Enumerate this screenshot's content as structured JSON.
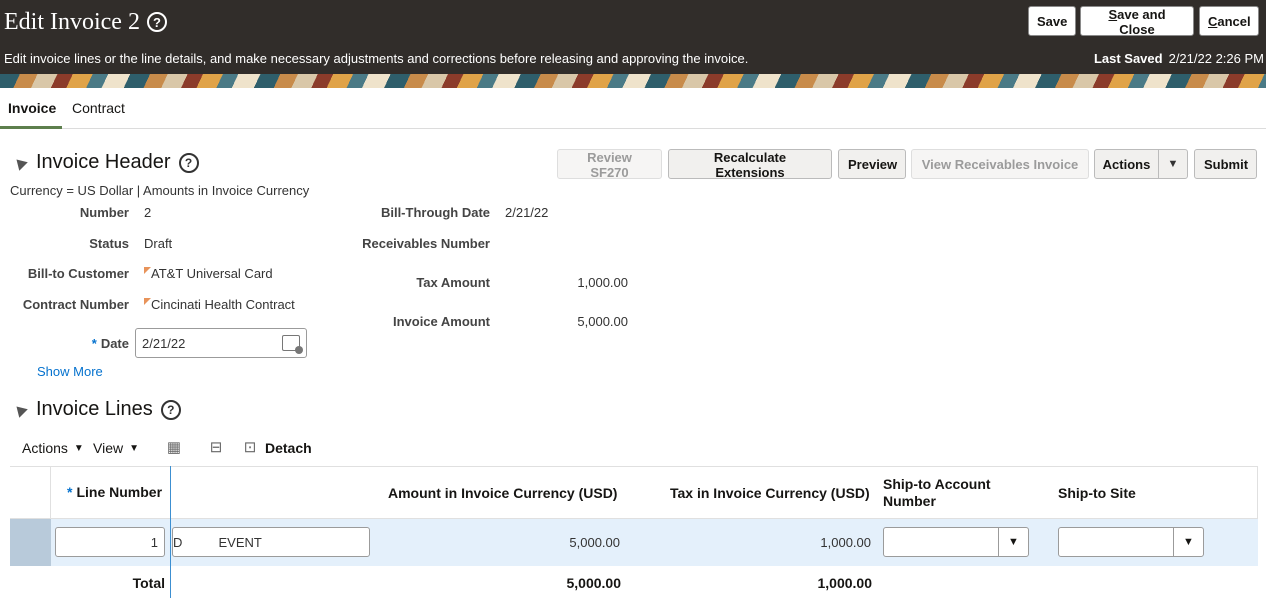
{
  "header": {
    "title": "Edit Invoice 2",
    "help": "?",
    "subtitle": "Edit invoice lines or the line details, and make necessary adjustments and corrections before releasing and approving the invoice.",
    "last_saved_label": "Last Saved",
    "last_saved_value": "2/21/22 2:26 PM",
    "save": "Save",
    "save_close_s": "S",
    "save_close_rest": "ave and Close",
    "cancel_c": "C",
    "cancel_rest": "ancel"
  },
  "tabs": [
    {
      "label": "Invoice",
      "active": true
    },
    {
      "label": "Contract",
      "active": false
    }
  ],
  "invoice_header": {
    "title": "Invoice Header",
    "help": "?",
    "buttons": {
      "review": "Review SF270",
      "recalc": "Recalculate Extensions",
      "preview": "Preview",
      "view_receivables": "View Receivables Invoice",
      "actions": "Actions",
      "submit": "Submit"
    },
    "currency_line": "Currency = US Dollar | Amounts in Invoice Currency",
    "fields": {
      "number_label": "Number",
      "number_value": "2",
      "status_label": "Status",
      "status_value": "Draft",
      "customer_label": "Bill-to Customer",
      "customer_value": "AT&T Universal Card",
      "contract_label": "Contract Number",
      "contract_value": "Cincinati Health Contract",
      "date_label": "Date",
      "date_required": "*",
      "date_value": "2/21/22",
      "bill_through_label": "Bill-Through Date",
      "bill_through_value": "2/21/22",
      "receivables_label": "Receivables Number",
      "tax_label": "Tax Amount",
      "tax_value": "1,000.00",
      "invoice_amount_label": "Invoice Amount",
      "invoice_amount_value": "5,000.00"
    },
    "show_more": "Show More"
  },
  "invoice_lines": {
    "title": "Invoice Lines",
    "help": "?",
    "toolbar": {
      "actions": "Actions",
      "view": "View",
      "detach": "Detach"
    },
    "columns": {
      "line_number_req": "*",
      "line_number": "Line Number",
      "amount": "Amount in Invoice Currency (USD)",
      "tax": "Tax in Invoice Currency (USD)",
      "ship_account_1": "Ship-to Account",
      "ship_account_2": "Number",
      "ship_site": "Ship-to Site"
    },
    "row": {
      "line_number": "1",
      "description": "D          EVENT",
      "amount": "5,000.00",
      "tax": "1,000.00"
    },
    "total": {
      "label": "Total",
      "amount": "5,000.00",
      "tax": "1,000.00"
    }
  },
  "colors": {
    "accent": "#0572ce",
    "header_bg": "#312d2a",
    "tab_underline": "#5d7f4d",
    "row_selected": "#e4f0fb"
  },
  "icons": [
    "help-icon",
    "collapse-triangle-icon",
    "calendar-icon",
    "dropdown-arrow-icon",
    "freeze-columns-icon",
    "wrap-icon",
    "detach-icon",
    "flag-icon"
  ]
}
